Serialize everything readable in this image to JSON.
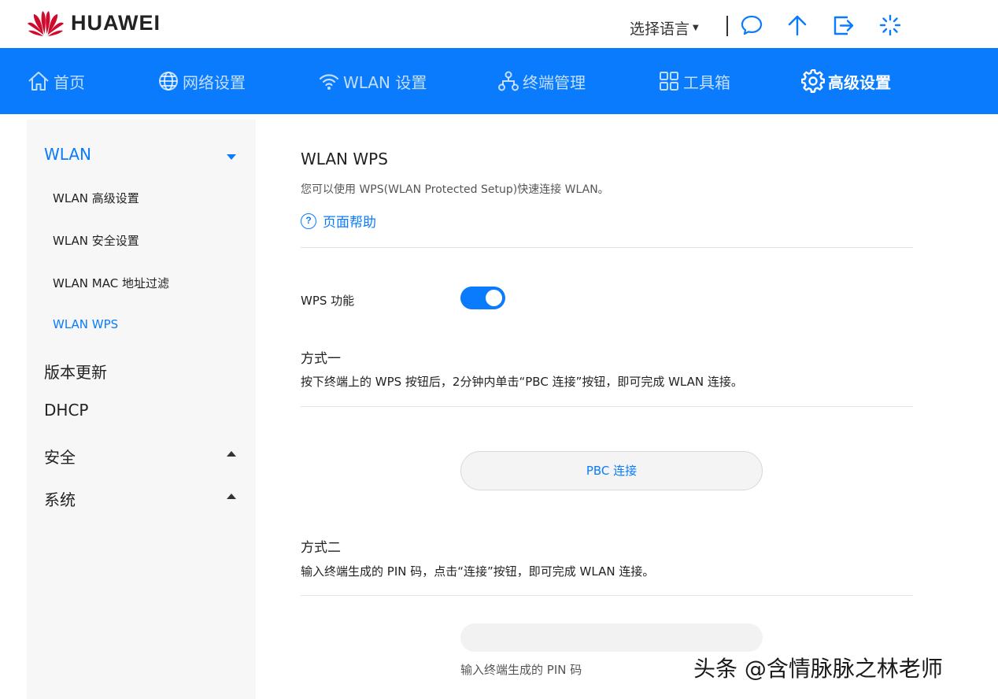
{
  "brand": {
    "name": "HUAWEI"
  },
  "header": {
    "language_label": "选择语言",
    "icons": [
      "chat-icon",
      "upload-icon",
      "logout-icon",
      "loading-icon"
    ]
  },
  "nav": {
    "items": [
      {
        "label": "首页",
        "icon": "home-icon"
      },
      {
        "label": "网络设置",
        "icon": "globe-icon"
      },
      {
        "label": "WLAN 设置",
        "icon": "wifi-icon"
      },
      {
        "label": "终端管理",
        "icon": "devices-icon"
      },
      {
        "label": "工具箱",
        "icon": "toolbox-icon"
      },
      {
        "label": "高级设置",
        "icon": "gear-icon",
        "active": true
      }
    ]
  },
  "sidebar": {
    "wlan": {
      "label": "WLAN",
      "items": [
        "WLAN 高级设置",
        "WLAN 安全设置",
        "WLAN MAC 地址过滤",
        "WLAN WPS"
      ],
      "active_item": "WLAN WPS"
    },
    "version": "版本更新",
    "dhcp": "DHCP",
    "security": "安全",
    "system": "系统"
  },
  "main": {
    "title": "WLAN WPS",
    "description": "您可以使用 WPS(WLAN Protected Setup)快速连接 WLAN。",
    "help_label": "页面帮助",
    "wps_label": "WPS 功能",
    "wps_enabled": true,
    "method1": {
      "title": "方式一",
      "text": "按下终端上的 WPS 按钮后，2分钟内单击“PBC 连接”按钮，即可完成 WLAN 连接。",
      "button": "PBC 连接"
    },
    "method2": {
      "title": "方式二",
      "text": "输入终端生成的 PIN 码，点击“连接”按钮，即可完成 WLAN 连接。",
      "pin_value": "",
      "pin_hint": "输入终端生成的 PIN 码"
    }
  },
  "watermark": "头条 @含情脉脉之林老师",
  "colors": {
    "accent": "#0a7bfd",
    "brand_red": "#cf0a2c"
  }
}
